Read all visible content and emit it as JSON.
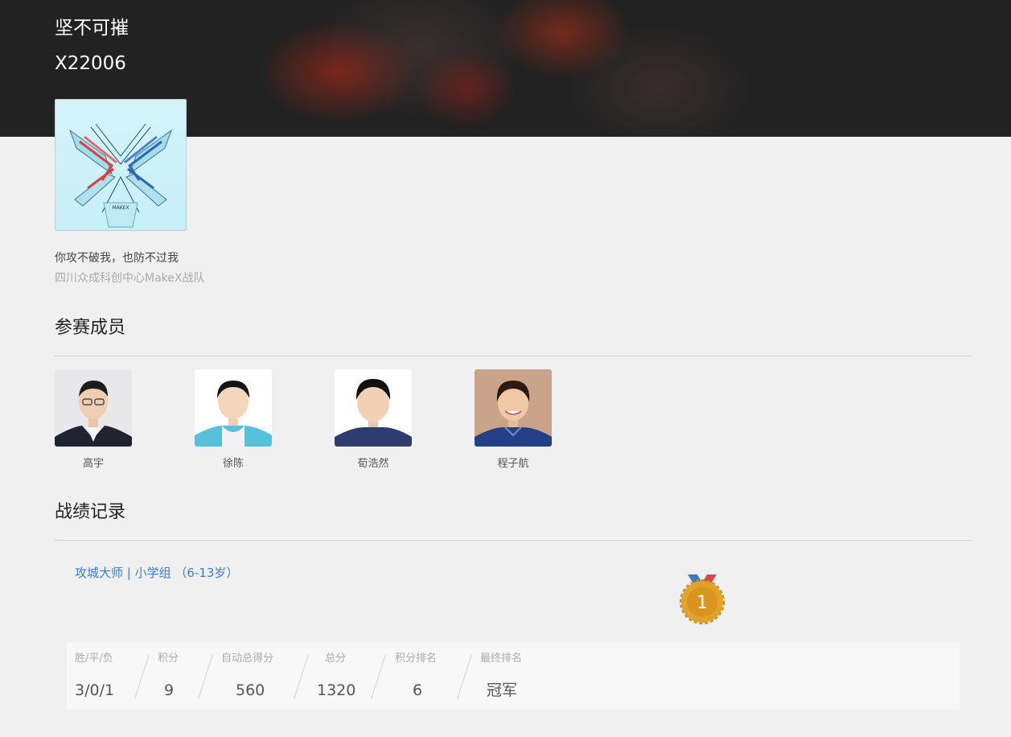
{
  "team": {
    "name": "坚不可摧",
    "code": "X22006",
    "logo_text": "MAKEX",
    "slogan": "你攻不破我，也防不过我",
    "organization": "四川众成科创中心MakeX战队"
  },
  "members_section": {
    "title": "参赛成员",
    "members": [
      {
        "name": "高宇"
      },
      {
        "name": "徐陈"
      },
      {
        "name": "荀浩然"
      },
      {
        "name": "程子航"
      }
    ]
  },
  "records_section": {
    "title": "战绩记录",
    "competition_link": "攻城大师 | 小学组 （6-13岁）",
    "medal_rank": "1",
    "stats": [
      {
        "label": "胜/平/负",
        "value": "3/0/1"
      },
      {
        "label": "积分",
        "value": "9"
      },
      {
        "label": "自动总得分",
        "value": "560"
      },
      {
        "label": "总分",
        "value": "1320"
      },
      {
        "label": "积分排名",
        "value": "6"
      },
      {
        "label": "最终排名",
        "value": "冠军"
      }
    ]
  },
  "colors": {
    "hero_bg": "#222222",
    "link": "#3d7cc9",
    "medal_gold": "#e3a32a",
    "page_bg": "#f0f0f0"
  }
}
